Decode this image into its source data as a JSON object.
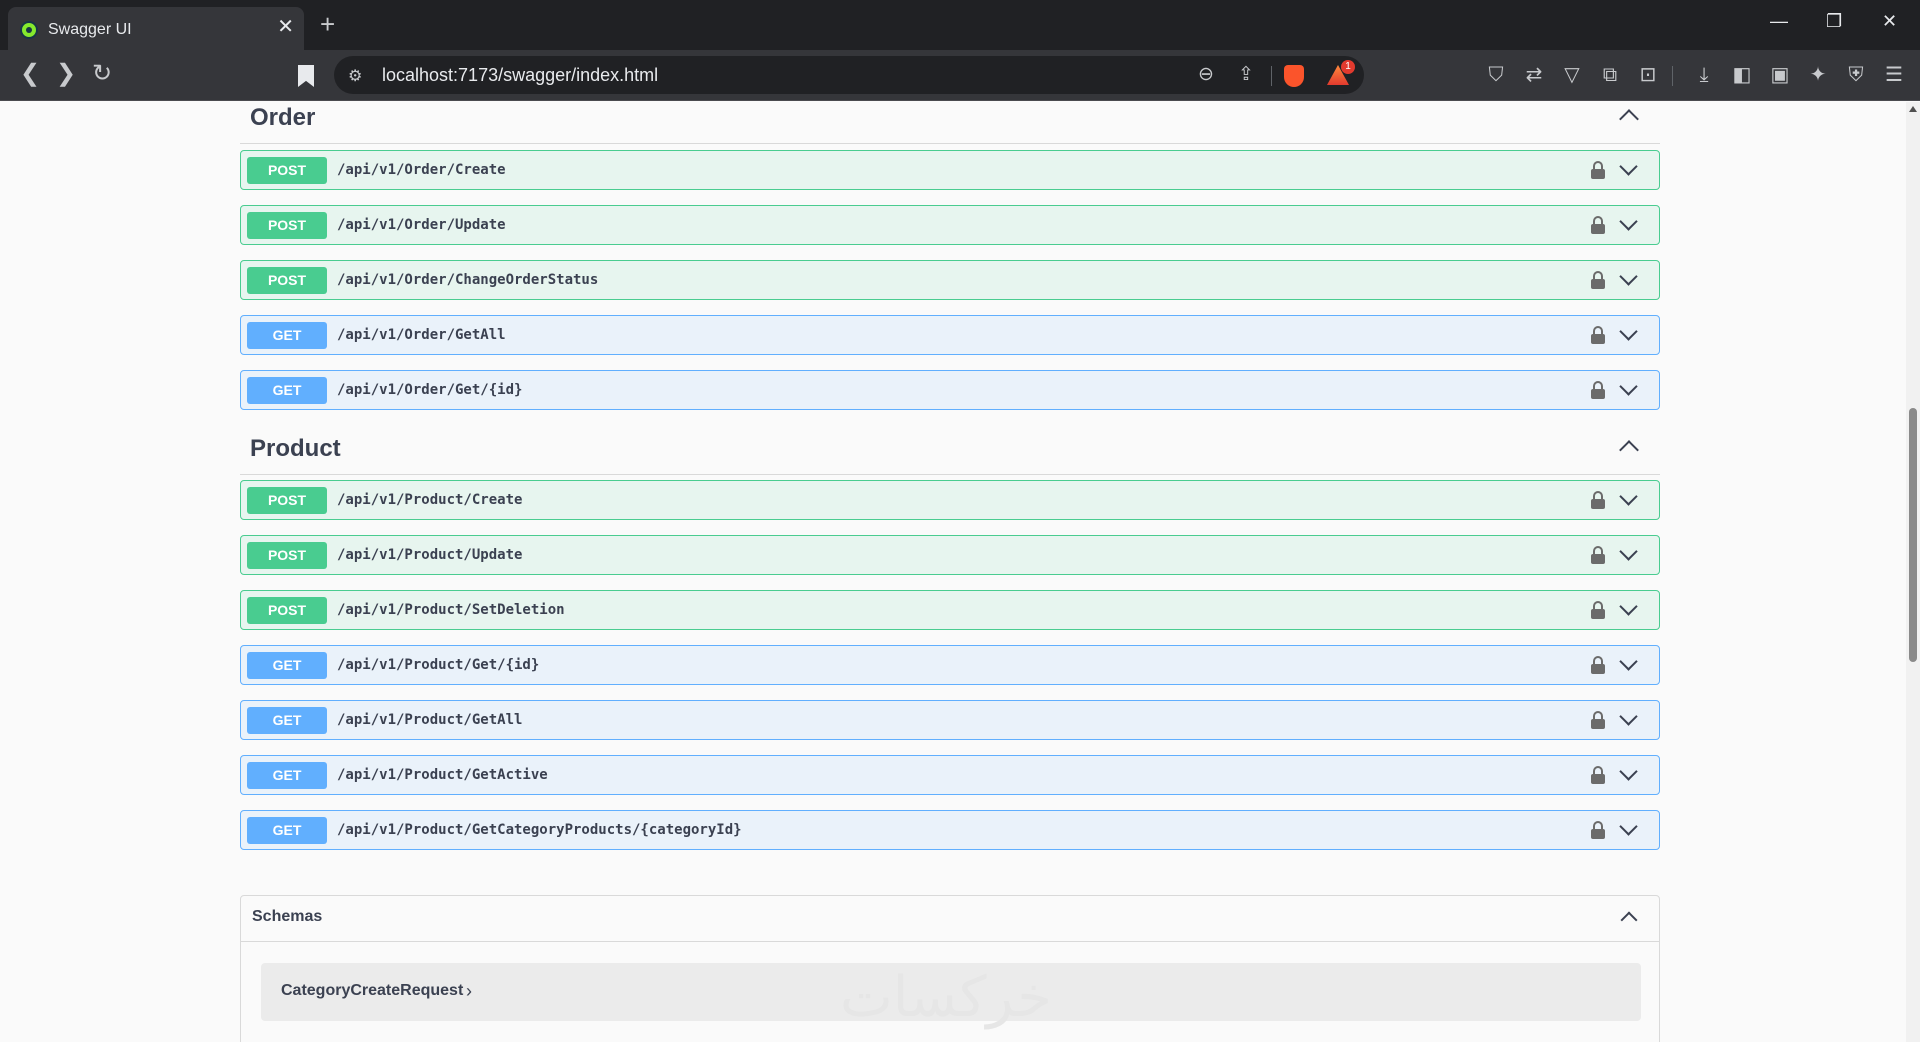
{
  "browser": {
    "tab_title": "Swagger UI",
    "tab_close": "✕",
    "new_tab": "+",
    "url": "localhost:7173/swagger/index.html",
    "rewards_badge": "1",
    "window_controls": {
      "minimize": "—",
      "restore": "❐",
      "close": "✕"
    },
    "icons": [
      "back-icon",
      "forward-icon",
      "reload-icon",
      "bookmark-icon",
      "site-info-icon",
      "zoom-icon",
      "share-icon",
      "brave-shields-icon",
      "brave-rewards-icon",
      "extensions",
      "downloads-icon",
      "sidebar-icon",
      "wallet-icon",
      "leo-icon",
      "vpn-icon",
      "menu-icon"
    ]
  },
  "order": {
    "title": "Order",
    "operations": [
      {
        "method": "POST",
        "path": "/api/v1/Order/Create"
      },
      {
        "method": "POST",
        "path": "/api/v1/Order/Update"
      },
      {
        "method": "POST",
        "path": "/api/v1/Order/ChangeOrderStatus"
      },
      {
        "method": "GET",
        "path": "/api/v1/Order/GetAll"
      },
      {
        "method": "GET",
        "path": "/api/v1/Order/Get/{id}"
      }
    ]
  },
  "product": {
    "title": "Product",
    "operations": [
      {
        "method": "POST",
        "path": "/api/v1/Product/Create"
      },
      {
        "method": "POST",
        "path": "/api/v1/Product/Update"
      },
      {
        "method": "POST",
        "path": "/api/v1/Product/SetDeletion"
      },
      {
        "method": "GET",
        "path": "/api/v1/Product/Get/{id}"
      },
      {
        "method": "GET",
        "path": "/api/v1/Product/GetAll"
      },
      {
        "method": "GET",
        "path": "/api/v1/Product/GetActive"
      },
      {
        "method": "GET",
        "path": "/api/v1/Product/GetCategoryProducts/{categoryId}"
      }
    ]
  },
  "schemas": {
    "title": "Schemas",
    "models": [
      {
        "name": "CategoryCreateRequest",
        "arrow": "›"
      }
    ]
  },
  "watermark": "خرکسات",
  "colors": {
    "post": "#49cc90",
    "get": "#61affe",
    "text": "#3b4151"
  }
}
